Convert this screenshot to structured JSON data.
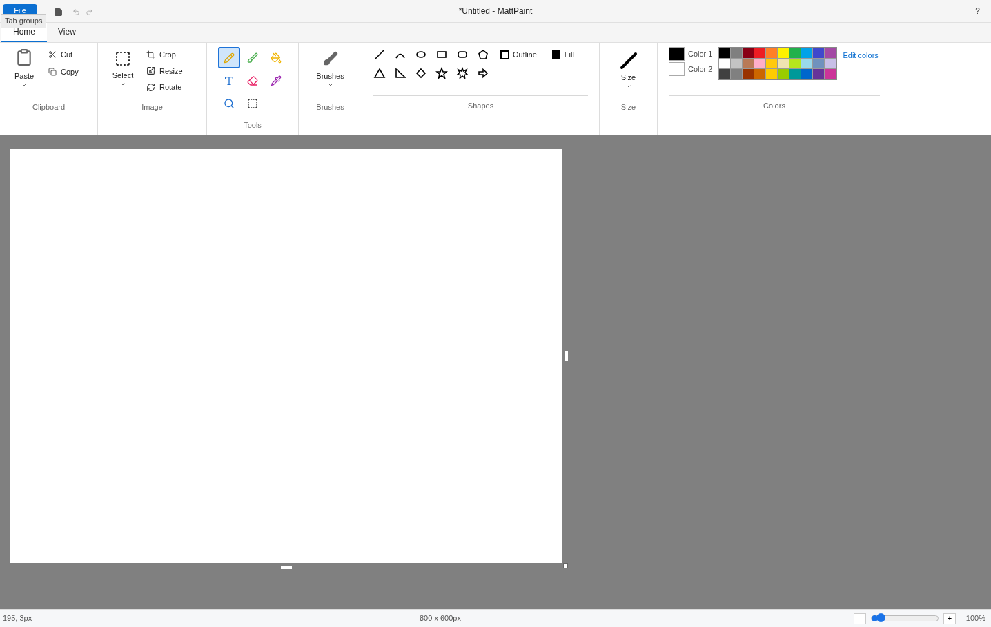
{
  "window": {
    "title": "*Untitled - MattPaint",
    "help": "?"
  },
  "file_button": "File",
  "tooltip": "Tab groups",
  "tabs": [
    {
      "label": "Home",
      "selected": true
    },
    {
      "label": "View",
      "selected": false
    }
  ],
  "clipboard": {
    "paste": "Paste",
    "cut": "Cut",
    "copy": "Copy",
    "label": "Clipboard"
  },
  "image": {
    "select": "Select",
    "crop": "Crop",
    "resize": "Resize",
    "rotate": "Rotate",
    "label": "Image"
  },
  "tools": {
    "label": "Tools",
    "items": [
      {
        "kind": "pencil",
        "selected": true
      },
      {
        "kind": "brush",
        "selected": false
      },
      {
        "kind": "fill",
        "selected": false
      },
      {
        "kind": "text",
        "selected": false
      },
      {
        "kind": "eraser",
        "selected": false
      },
      {
        "kind": "picker",
        "selected": false
      },
      {
        "kind": "magnifier",
        "selected": false
      },
      {
        "kind": "selection",
        "selected": false
      }
    ]
  },
  "brushes": {
    "button": "Brushes",
    "label": "Brushes"
  },
  "shapes": {
    "label": "Shapes",
    "outline": "Outline",
    "fill": "Fill",
    "items": [
      {
        "kind": "line"
      },
      {
        "kind": "curve"
      },
      {
        "kind": "ellipse"
      },
      {
        "kind": "rectangle"
      },
      {
        "kind": "rounded"
      },
      {
        "kind": "pentagon"
      },
      {
        "kind": "triangle"
      },
      {
        "kind": "right-triangle"
      },
      {
        "kind": "diamond"
      },
      {
        "kind": "star"
      },
      {
        "kind": "burst"
      },
      {
        "kind": "arrow"
      }
    ]
  },
  "size": {
    "button": "Size",
    "label": "Size"
  },
  "colors": {
    "label": "Colors",
    "color1": {
      "label": "Color 1",
      "color": "#000000"
    },
    "color2": {
      "label": "Color 2",
      "color": "#ffffff"
    },
    "edit": "Edit colors",
    "palette": [
      {
        "color": "#000000"
      },
      {
        "color": "#7f7f7f"
      },
      {
        "color": "#880015"
      },
      {
        "color": "#ed1c24"
      },
      {
        "color": "#ff7f27"
      },
      {
        "color": "#fff200"
      },
      {
        "color": "#22b14c"
      },
      {
        "color": "#00a2e8"
      },
      {
        "color": "#3f48cc"
      },
      {
        "color": "#a349a4"
      },
      {
        "color": "#ffffff"
      },
      {
        "color": "#c3c3c3"
      },
      {
        "color": "#b97a57"
      },
      {
        "color": "#ffaec9"
      },
      {
        "color": "#ffc90e"
      },
      {
        "color": "#efe4b0"
      },
      {
        "color": "#b5e61d"
      },
      {
        "color": "#99d9ea"
      },
      {
        "color": "#7092be"
      },
      {
        "color": "#c8bfe7"
      },
      {
        "color": "#404040"
      },
      {
        "color": "#808080"
      },
      {
        "color": "#993300"
      },
      {
        "color": "#cc6600"
      },
      {
        "color": "#ffcc00"
      },
      {
        "color": "#99cc00"
      },
      {
        "color": "#009999"
      },
      {
        "color": "#0066cc"
      },
      {
        "color": "#663399"
      },
      {
        "color": "#cc3399"
      }
    ]
  },
  "status_bar": {
    "position": "195, 3px",
    "dimensions": "800 x 600px",
    "zoom_out": "-",
    "zoom_in": "+",
    "zoom": {
      "level": 0.1
    },
    "zoom_reading": "100%"
  }
}
